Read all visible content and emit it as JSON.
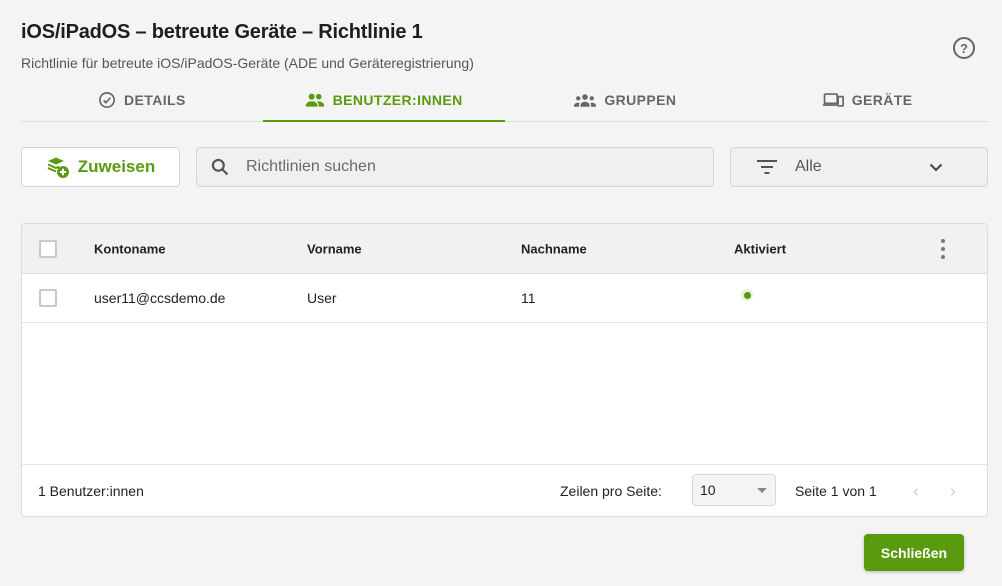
{
  "header": {
    "title": "iOS/iPadOS – betreute Geräte – Richtlinie 1",
    "subtitle": "Richtlinie für betreute iOS/iPadOS-Geräte (ADE und Geräteregistrierung)",
    "help_icon": "help-circle-icon"
  },
  "tabs": [
    {
      "label": "DETAILS",
      "icon": "check-circle-icon",
      "active": false
    },
    {
      "label": "BENUTZER:INNEN",
      "icon": "users-icon",
      "active": true
    },
    {
      "label": "GRUPPEN",
      "icon": "groups-icon",
      "active": false
    },
    {
      "label": "GERÄTE",
      "icon": "devices-icon",
      "active": false
    }
  ],
  "toolbar": {
    "assign_label": "Zuweisen",
    "search_placeholder": "Richtlinien suchen",
    "search_value": "",
    "filter_value": "Alle"
  },
  "table": {
    "columns": [
      "Kontoname",
      "Vorname",
      "Nachname",
      "Aktiviert"
    ],
    "rows": [
      {
        "account": "user11@ccsdemo.de",
        "first_name": "User",
        "last_name": "11",
        "activated": true
      }
    ]
  },
  "footer": {
    "count_label": "1 Benutzer:innen",
    "rows_per_page_label": "Zeilen pro Seite:",
    "rows_per_page_value": "10",
    "page_info": "Seite 1 von 1"
  },
  "actions": {
    "close_label": "Schließen"
  },
  "colors": {
    "accent": "#5a9a0f",
    "background": "#f4f4f4"
  }
}
